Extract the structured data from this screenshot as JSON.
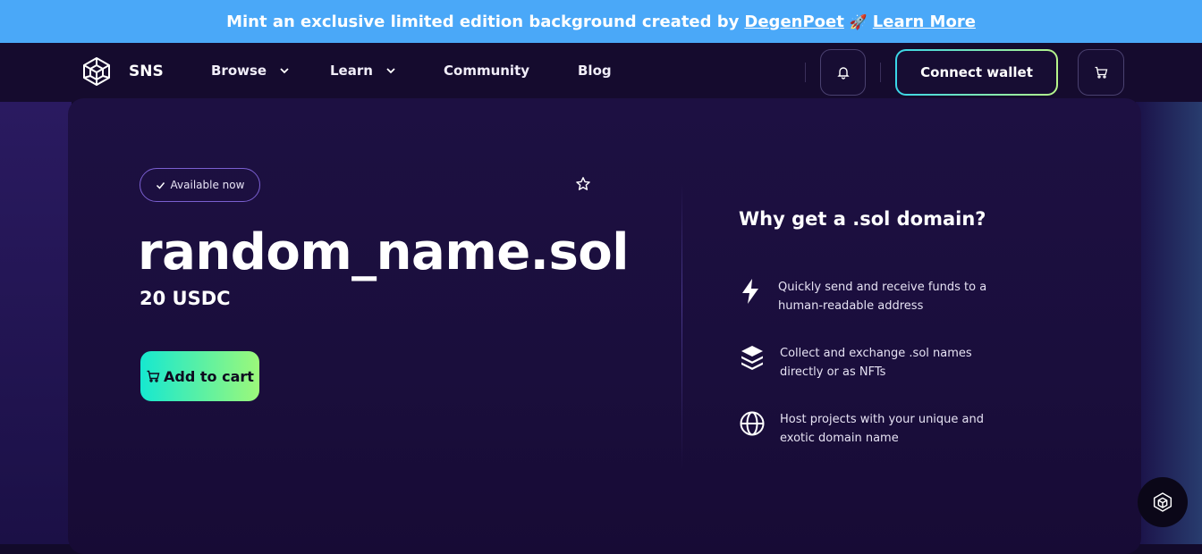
{
  "banner": {
    "text": "Mint an exclusive limited edition background created by",
    "author_link": "DegenPoet",
    "emoji": "🚀",
    "learn_more": "Learn More",
    "bg_color": "#4aa8f8"
  },
  "nav": {
    "brand": "SNS",
    "logo_icon": "cube-icon",
    "items": [
      {
        "label": "Browse",
        "has_dropdown": true
      },
      {
        "label": "Learn",
        "has_dropdown": true
      },
      {
        "label": "Community",
        "has_dropdown": false
      },
      {
        "label": "Blog",
        "has_dropdown": false
      }
    ],
    "notification_icon": "bell-icon",
    "connect_label": "Connect wallet",
    "cart_icon": "cart-icon"
  },
  "domain": {
    "status": "Available now",
    "name": "random_name.sol",
    "price": "20 USDC",
    "add_to_cart": "Add to cart",
    "favorite_icon": "star-icon"
  },
  "why": {
    "title": "Why get a .sol domain?",
    "features": [
      {
        "icon": "lightning-icon",
        "text": "Quickly send and receive funds to a human-readable address"
      },
      {
        "icon": "layers-icon",
        "text": "Collect and exchange .sol names directly or as NFTs"
      },
      {
        "icon": "globe-icon",
        "text": "Host projects with your unique and exotic domain name"
      }
    ]
  },
  "colors": {
    "accent_gradient_start": "#16e8d0",
    "accent_gradient_end": "#9cf87a",
    "background": "#120a2a"
  }
}
